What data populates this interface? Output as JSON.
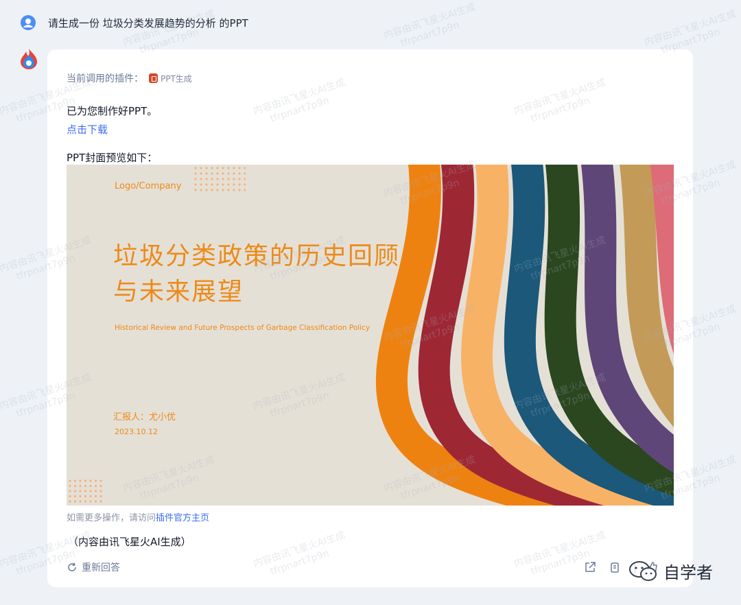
{
  "user_message": "请生成一份 垃圾分类发展趋势的分析 的PPT",
  "plugin": {
    "label": "当前调用的插件：",
    "name": "PPT生成"
  },
  "response": {
    "made_text": "已为您制作好PPT。",
    "download_link": "点击下载",
    "preview_label": "PPT封面预览如下："
  },
  "slide": {
    "logo": "Logo/Company",
    "title": "垃圾分类政策的历史回顾与未来展望",
    "subtitle": "Historical Review and Future Prospects of Garbage Classification Policy",
    "reporter": "汇报人：尤小优",
    "date": "2023.10.12",
    "stripe_colors": [
      "#ee8211",
      "#9e2734",
      "#f8b265",
      "#1b587a",
      "#2a4720",
      "#5f4678",
      "#c39a58",
      "#dd6b78"
    ],
    "accent_color": "#ec8a19"
  },
  "footer": {
    "more_ops_prefix": "如需更多操作，请访问",
    "more_ops_link": "插件官方主页",
    "generated_note": "（内容由讯飞星火AI生成）",
    "regenerate": "重新回答"
  },
  "brand_watermark": "自学者",
  "watermark": {
    "line1": "内容由讯飞星火AI生成",
    "line2": "tfrpnart7p9n"
  }
}
